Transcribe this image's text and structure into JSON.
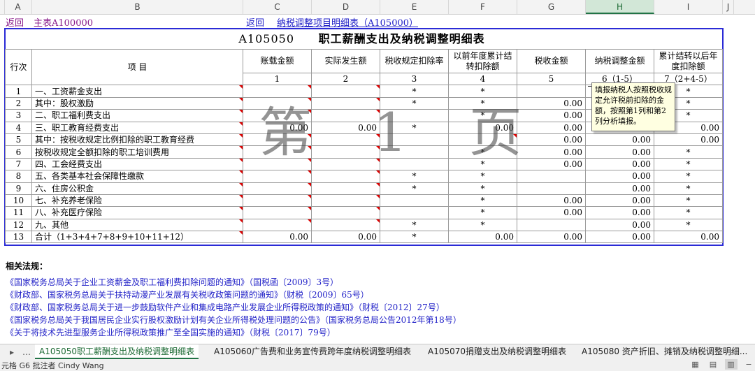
{
  "columns": [
    {
      "letter": "A",
      "w": 46
    },
    {
      "letter": "B",
      "w": 302
    },
    {
      "letter": "C",
      "w": 98
    },
    {
      "letter": "D",
      "w": 98
    },
    {
      "letter": "E",
      "w": 98
    },
    {
      "letter": "F",
      "w": 98
    },
    {
      "letter": "G",
      "w": 98
    },
    {
      "letter": "H",
      "w": 98
    },
    {
      "letter": "I",
      "w": 98
    },
    {
      "letter": "J",
      "w": 16
    }
  ],
  "selected_column": "H",
  "top_links": {
    "back1": "返回",
    "main_table": "主表A100000",
    "back2": "返回",
    "adjust_table": "纳税调整项目明细表（A105000）"
  },
  "form_title": {
    "code": "A105050",
    "name": "职工薪酬支出及纳税调整明细表"
  },
  "headers": {
    "line": "行次",
    "item": "项          目",
    "c1": "账载金额",
    "c2": "实际发生额",
    "c3": "税收规定扣除率",
    "c4": "以前年度累计结转扣除额",
    "c5": "税收金额",
    "c6": "纳税调整金额",
    "c7": "累计结转以后年度扣除额"
  },
  "header_nums": [
    "1",
    "2",
    "3",
    "4",
    "5",
    "6（1-5）",
    "7（2+4-5）"
  ],
  "rows": [
    {
      "n": "1",
      "item": "一、工资薪金支出",
      "c1": "",
      "c2": "",
      "c3": "*",
      "c4": "*",
      "c5": "",
      "c6": "",
      "c7": "*"
    },
    {
      "n": "2",
      "item": "    其中：股权激励",
      "c1": "",
      "c2": "",
      "c3": "*",
      "c4": "*",
      "c5": "0.00",
      "c6": "",
      "c7": "*"
    },
    {
      "n": "3",
      "item": "二、职工福利费支出",
      "c1": "",
      "c2": "",
      "c3": "",
      "c4": "*",
      "c5": "0.00",
      "c6": "",
      "c7": "*"
    },
    {
      "n": "4",
      "item": "三、职工教育经费支出",
      "c1": "0.00",
      "c2": "0.00",
      "c3": "*",
      "c4": "0.00",
      "c5": "0.00",
      "c6": "",
      "c7": "0.00"
    },
    {
      "n": "5",
      "item": "    其中：按税收规定比例扣除的职工教育经费",
      "c1": "",
      "c2": "",
      "c3": "",
      "c4": "",
      "c5": "0.00",
      "c6": "0.00",
      "c7": "0.00"
    },
    {
      "n": "6",
      "item": "          按税收规定全额扣除的职工培训费用",
      "c1": "",
      "c2": "",
      "c3": "",
      "c4": "*",
      "c5": "0.00",
      "c6": "0.00",
      "c7": "*"
    },
    {
      "n": "7",
      "item": "四、工会经费支出",
      "c1": "",
      "c2": "",
      "c3": "",
      "c4": "*",
      "c5": "0.00",
      "c6": "0.00",
      "c7": "*"
    },
    {
      "n": "8",
      "item": "五、各类基本社会保障性缴款",
      "c1": "",
      "c2": "",
      "c3": "*",
      "c4": "*",
      "c5": "",
      "c6": "0.00",
      "c7": "*"
    },
    {
      "n": "9",
      "item": "六、住房公积金",
      "c1": "",
      "c2": "",
      "c3": "*",
      "c4": "*",
      "c5": "",
      "c6": "0.00",
      "c7": "*"
    },
    {
      "n": "10",
      "item": "七、补充养老保险",
      "c1": "",
      "c2": "",
      "c3": "",
      "c4": "*",
      "c5": "0.00",
      "c6": "0.00",
      "c7": "*"
    },
    {
      "n": "11",
      "item": "八、补充医疗保险",
      "c1": "",
      "c2": "",
      "c3": "",
      "c4": "*",
      "c5": "0.00",
      "c6": "0.00",
      "c7": "*"
    },
    {
      "n": "12",
      "item": "九、其他",
      "c1": "",
      "c2": "",
      "c3": "*",
      "c4": "*",
      "c5": "",
      "c6": "0.00",
      "c7": "*"
    },
    {
      "n": "13",
      "item": "合计（1+3+4+7+8+9+10+11+12）",
      "c1": "0.00",
      "c2": "0.00",
      "c3": "*",
      "c4": "0.00",
      "c5": "0.00",
      "c6": "0.00",
      "c7": "0.00"
    }
  ],
  "watermark": "第 1 页",
  "comment_text": "填报纳税人按照税收规定允许税前扣除的金额，按照第1列和第2列分析填报。",
  "laws": {
    "title": "相关法规：",
    "items": [
      "《国家税务总局关于企业工资薪金及职工福利费扣除问题的通知》（国税函〔2009〕3号）",
      "《财政部、国家税务总局关于扶持动漫产业发展有关税收政策问题的通知》（财税〔2009〕65号）",
      "《财政部、国家税务总局关于进一步鼓励软件产业和集成电路产业发展企业所得税政策的通知》（财税〔2012〕27号）",
      "《国家税务总局关于我国居民企业实行股权激励计划有关企业所得税处理问题的公告》（国家税务总局公告2012年第18号）",
      "《关于将技术先进型服务企业所得税政策推广至全国实施的通知》（财税〔2017〕79号）"
    ]
  },
  "sheet_tabs": [
    "A105050职工薪酬支出及纳税调整明细表",
    "A105060广告费和业务宣传费跨年度纳税调整明细表",
    "A105070捐赠支出及纳税调整明细表",
    "A105080 资产折旧、摊销及纳税调整明细..."
  ],
  "status_text": "元格 G6 批注者 Cindy Wang",
  "colors": {
    "link": "#2323c8",
    "accent": "#217346",
    "frame": "#2b2bd6",
    "marker": "#dd0000"
  }
}
